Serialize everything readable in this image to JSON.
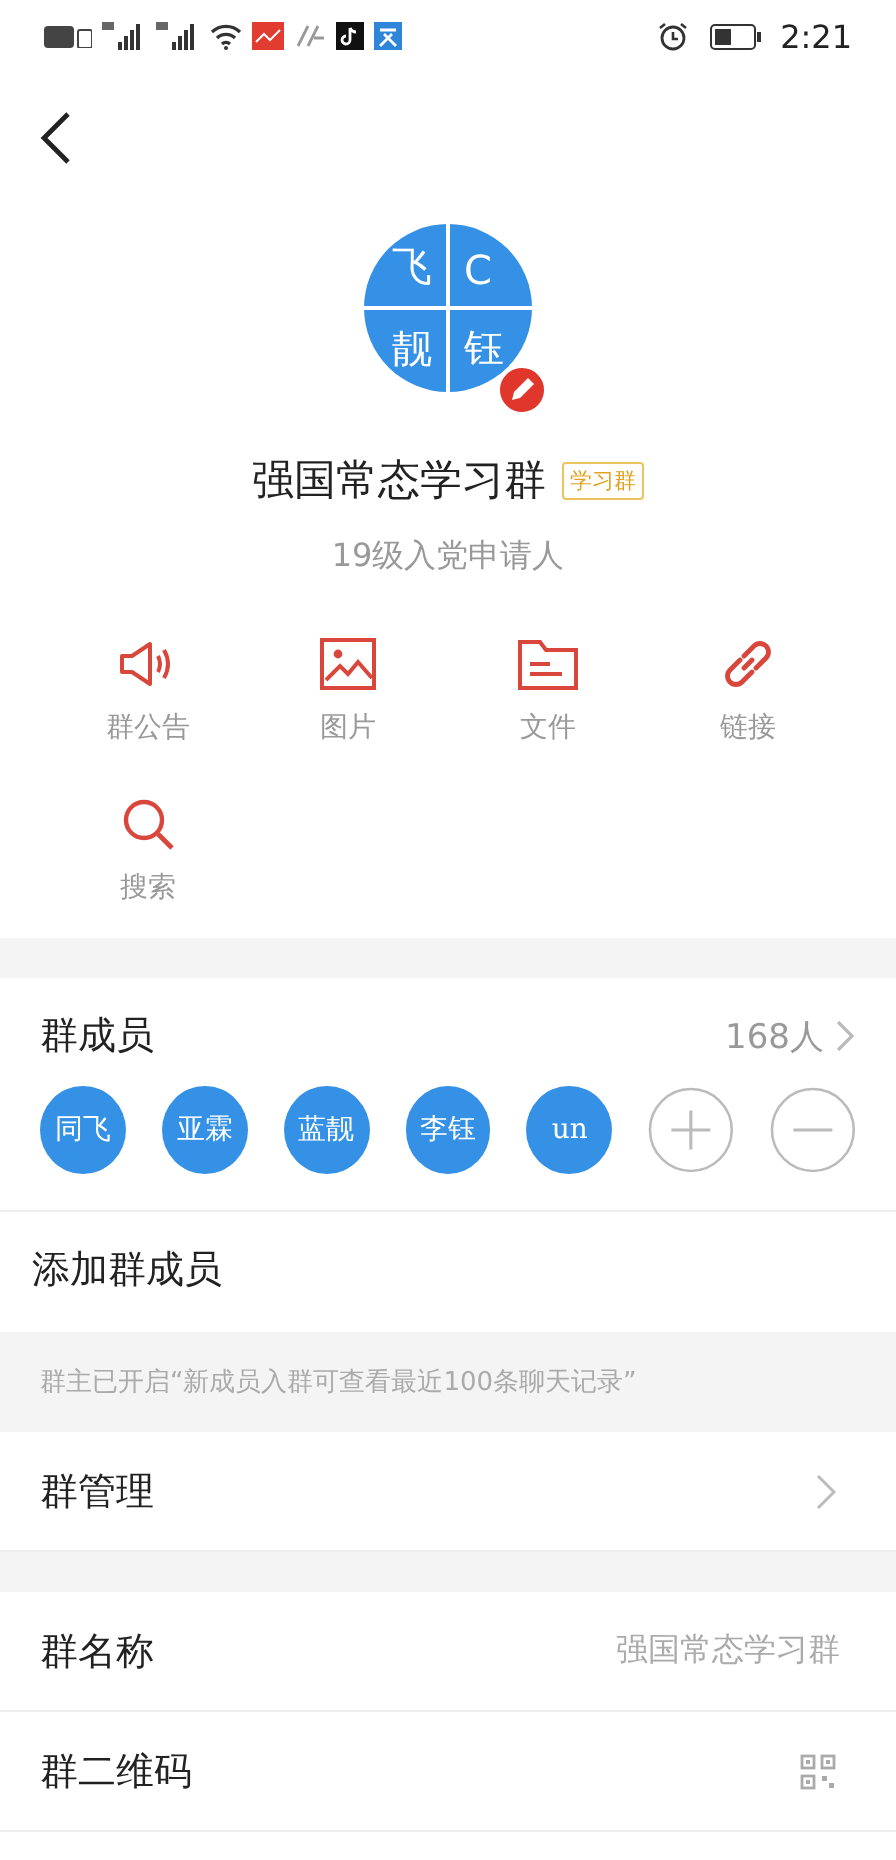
{
  "status_bar": {
    "time": "2:21"
  },
  "group": {
    "avatar_tiles": [
      "飞",
      "C",
      "靓",
      "钰"
    ],
    "name": "强国常态学习群",
    "badge": "学习群",
    "description": "19级入党申请人"
  },
  "actions": [
    {
      "kind": "announcement",
      "label": "群公告"
    },
    {
      "kind": "image",
      "label": "图片"
    },
    {
      "kind": "file",
      "label": "文件"
    },
    {
      "kind": "link",
      "label": "链接"
    },
    {
      "kind": "search",
      "label": "搜索"
    }
  ],
  "members": {
    "title": "群成员",
    "count": "168人",
    "avatars": [
      "同飞",
      "亚霖",
      "蓝靓",
      "李钰",
      "un"
    ]
  },
  "add_member": "添加群成员",
  "notice": "群主已开启“新成员入群可查看最近100条聊天记录”",
  "settings_groups": [
    [
      {
        "kind": "link",
        "label": "群管理"
      }
    ],
    [
      {
        "kind": "value",
        "label": "群名称",
        "value": "强国常态学习群"
      },
      {
        "kind": "qr",
        "label": "群二维码"
      }
    ]
  ]
}
